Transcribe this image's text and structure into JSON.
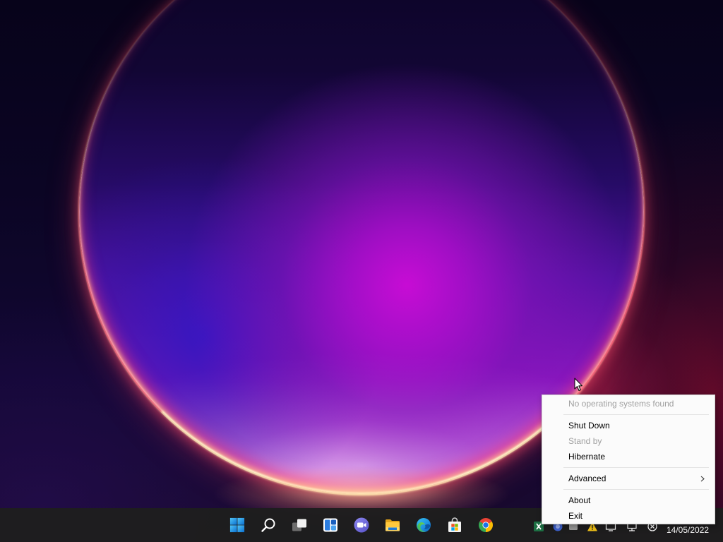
{
  "colors": {
    "taskbar_bg": "#1e1e1e",
    "menu_bg": "#fbfbfb",
    "menu_text": "#000000",
    "menu_text_disabled": "#a0a0a0",
    "accent": "#0078d4"
  },
  "taskbar": {
    "pinned": [
      {
        "icon": "start-icon"
      },
      {
        "icon": "search-icon"
      },
      {
        "icon": "task-view-icon"
      },
      {
        "icon": "widgets-icon"
      },
      {
        "icon": "chat-icon"
      },
      {
        "icon": "file-explorer-icon"
      },
      {
        "icon": "edge-icon"
      },
      {
        "icon": "store-icon"
      },
      {
        "icon": "chrome-icon"
      }
    ],
    "tray": {
      "icons": [
        "spreadsheet-icon",
        "blue-circle-icon",
        "gray-app-icon",
        "warning-icon",
        "display-icon",
        "network-icon",
        "circle-x-icon"
      ],
      "date": "14/05/2022"
    }
  },
  "context_menu": {
    "items": [
      {
        "label": "No operating systems found",
        "enabled": false
      },
      {
        "separator": true
      },
      {
        "label": "Shut Down",
        "enabled": true
      },
      {
        "label": "Stand by",
        "enabled": false
      },
      {
        "label": "Hibernate",
        "enabled": true
      },
      {
        "separator": true
      },
      {
        "label": "Advanced",
        "enabled": true,
        "has_submenu": true,
        "submenu_icon": "chevron-right-icon"
      },
      {
        "separator": true
      },
      {
        "label": "About",
        "enabled": true
      },
      {
        "label": "Exit",
        "enabled": true
      }
    ]
  }
}
